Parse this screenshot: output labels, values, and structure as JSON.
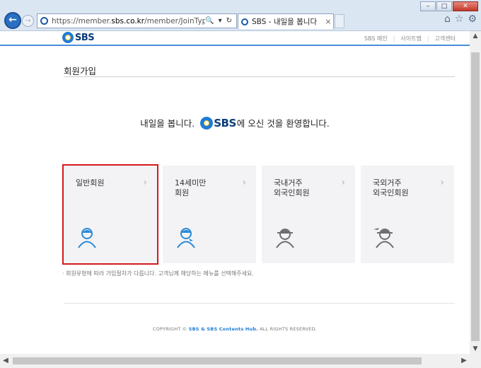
{
  "browser": {
    "url_prefix": "https://member.",
    "url_domain": "sbs.co.kr",
    "url_path": "/member/JoinType.do",
    "search_icon": "🔍",
    "dropdown_icon": "▾",
    "refresh_icon": "↻",
    "tab_title": "SBS - 내일을 봅니다",
    "tab_close": "×",
    "back": "←",
    "forward": "→",
    "home_icon": "⌂",
    "favorites_icon": "☆",
    "settings_icon": "⚙",
    "minimize": "–",
    "maximize": "□",
    "close": "✕"
  },
  "gnb": {
    "logo_text": "SBS",
    "links": [
      "SBS 메인",
      "사이트맵",
      "고객센터"
    ],
    "separator": "|"
  },
  "page": {
    "title": "회원가입",
    "welcome_before": "내일을 봅니다.",
    "welcome_logo": "SBS",
    "welcome_after": "에 오신 것을 환영합니다.",
    "note": "· 회원유형에 따라 가입절차가 다릅니다. 고객님께 해당하는 메뉴를 선택해주세요.",
    "copyright_prefix": "COPYRIGHT © ",
    "copyright_brand": "SBS & SBS Contents Hub.",
    "copyright_suffix": " ALL RIGHTS RESERVED."
  },
  "cards": [
    {
      "label": "일반회원",
      "icon": "person-icon",
      "selected": true
    },
    {
      "label": "14세미만\n회원",
      "icon": "child-person-icon",
      "selected": false
    },
    {
      "label": "국내거주\n외국인회원",
      "icon": "resident-foreigner-icon",
      "selected": false
    },
    {
      "label": "국외거주\n외국인회원",
      "icon": "overseas-foreigner-icon",
      "selected": false
    }
  ],
  "card_arrow": "›",
  "scroll": {
    "up": "▲",
    "down": "▼",
    "left": "◀",
    "right": "▶"
  },
  "colors": {
    "accent": "#1e7bd6",
    "selected_border": "#d8191c",
    "card_bg": "#f3f3f5",
    "icon_blue": "#2a8ad6",
    "icon_gray": "#6e6e6e"
  }
}
